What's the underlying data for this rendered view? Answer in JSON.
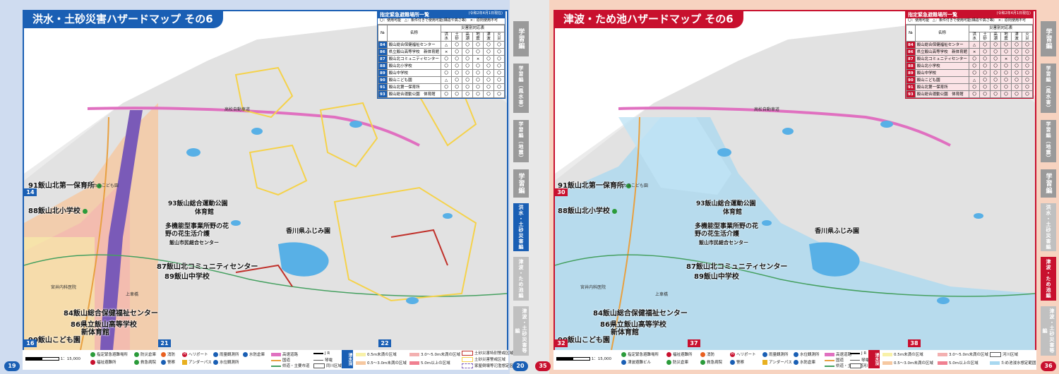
{
  "left_page": {
    "title": "洪水・土砂災害ハザードマップ その6",
    "page_number": "19",
    "corner_number": "20",
    "accent": "#1a5fb4",
    "grid_numbers": [
      "14",
      "16",
      "21",
      "22"
    ]
  },
  "right_page": {
    "title": "津波・ため池ハザードマップ その6",
    "page_number": "35",
    "corner_number": "36",
    "accent": "#c8102e",
    "grid_numbers": [
      "30",
      "32",
      "37",
      "38"
    ]
  },
  "shelter_table": {
    "title": "指定緊急避難場所一覧",
    "date": "(令和2年4月1日現在)",
    "note_left": "〇：使用可能　△：条件付きで使用可能(構造や高さ等)　×：原則使用不可",
    "note_right": "〇：使用可能　△：条件付きで使用可能(構造や高さ等)　×：原則使用不可",
    "col_no": "№",
    "col_name": "名称",
    "col_group": "災害別対応表",
    "cols": [
      "洪水",
      "土砂",
      "高潮",
      "地震",
      "津波",
      "火災"
    ],
    "rows": [
      {
        "no": "84",
        "name": "飯山総合保健福祉センター",
        "marks": [
          "△",
          "〇",
          "〇",
          "〇",
          "〇",
          "〇"
        ]
      },
      {
        "no": "86",
        "name": "県立飯山高等学校　新体育館",
        "marks": [
          "×",
          "〇",
          "〇",
          "〇",
          "〇",
          "〇"
        ]
      },
      {
        "no": "87",
        "name": "飯山北コミュニティセンター",
        "marks": [
          "〇",
          "〇",
          "〇",
          "×",
          "〇",
          "〇"
        ]
      },
      {
        "no": "88",
        "name": "飯山北小学校",
        "marks": [
          "〇",
          "〇",
          "〇",
          "〇",
          "〇",
          "〇"
        ]
      },
      {
        "no": "89",
        "name": "飯山中学校",
        "marks": [
          "〇",
          "〇",
          "〇",
          "〇",
          "〇",
          "〇"
        ]
      },
      {
        "no": "90",
        "name": "飯山こども園",
        "marks": [
          "△",
          "〇",
          "〇",
          "〇",
          "〇",
          "〇"
        ]
      },
      {
        "no": "91",
        "name": "飯山北第一保育所",
        "marks": [
          "〇",
          "〇",
          "〇",
          "〇",
          "〇",
          "〇"
        ]
      },
      {
        "no": "93",
        "name": "飯山総合運動公園　体育館",
        "marks": [
          "〇",
          "〇",
          "〇",
          "〇",
          "〇",
          "〇"
        ]
      }
    ]
  },
  "places": {
    "p91": "91飯山北第一保育所",
    "p88": "88飯山北小学校",
    "p93a": "93飯山総合運動公園",
    "p93b": "体育館",
    "tak_a": "多機能型事業所野の花",
    "tak_b": "野の花生活介護",
    "fujimi": "香川県ふじみ園",
    "shimin": "飯山市民総合センター",
    "p87": "87飯山北コミュニティセンター",
    "p89": "89飯山中学校",
    "p84": "84飯山総合保健福祉センター",
    "p86a": "86県立飯山高等学校",
    "p86b": "新体育館",
    "p90": "90飯山こども園",
    "doru": "ドルカスこども園",
    "miyai": "宮井内科医院",
    "kamikuruma": "上車橋",
    "highway": "高松自動車道"
  },
  "legend_left": {
    "shelter": "指定緊急避難場所",
    "welfare": "福祉避難所",
    "fire": "防災倉庫",
    "hospital": "救急病院",
    "fire_st": "消防",
    "police": "警察",
    "heliport": "ヘリポート",
    "underpass": "アンダーパス",
    "rain_obs": "雨量観測所",
    "level_obs": "水位観測所",
    "water_obs": "水防倉庫",
    "expressway": "高速道路",
    "national": "国道",
    "prefectural": "県道・主要市道",
    "jr": "J R",
    "private_rail": "琴電",
    "ward": "同川区域",
    "flood_title": "浸水深",
    "d1": "0.5m未満の区域",
    "d2": "0.5〜3.0m未満の区域",
    "d3": "3.0〜5.0m未満の区域",
    "d4": "5.0m以上の区域",
    "s1": "土砂災害特別警戒区域",
    "s2": "土砂災害警戒区域",
    "s3": "家屋倒壊等氾濫想定区域",
    "scale": "1：15,000"
  },
  "legend_right": {
    "shelter": "指定緊急避難場所",
    "welfare": "福祉避難所",
    "tsunami_bldg": "津波避難ビル",
    "fire": "防災倉庫",
    "hospital": "救急病院",
    "fire_st": "消防",
    "police": "警察",
    "heliport": "ヘリポート",
    "underpass": "アンダーパス",
    "rain_obs": "雨量観測所",
    "level_obs": "水位観測所",
    "water_obs": "水防倉庫",
    "expressway": "高速道路",
    "national": "国道",
    "prefectural": "県道・主要市道",
    "jr": "J R",
    "private_rail": "琴電",
    "ward": "河川区域",
    "flood_title": "浸水深",
    "d1": "0.5m未満の区域",
    "d2": "0.5〜3.0m未満の区域",
    "d3": "3.0〜5.0m未満の区域",
    "d4": "5.0m以上の区域",
    "s1": "河川区域",
    "s2": "ため池浸水想定範囲",
    "scale": "1：15,000"
  },
  "side_tabs": [
    "学習編",
    "学習編（風水害）",
    "学習編（地震）",
    "学習編",
    "洪水・土砂災害編",
    "津波・ため池編",
    "津波・土砂災害等編"
  ],
  "colors": {
    "blue": "#1a5fb4",
    "red": "#c8102e",
    "highway": "#e070c0",
    "river_band": "#7a5ab8",
    "flood_light": "#a8d8f0",
    "flood_orange": "#f6c8a0",
    "landslide_yellow": "#f5d24a",
    "page_bg_left": "#cfdcf0",
    "page_bg_right": "#f7d3c0"
  }
}
